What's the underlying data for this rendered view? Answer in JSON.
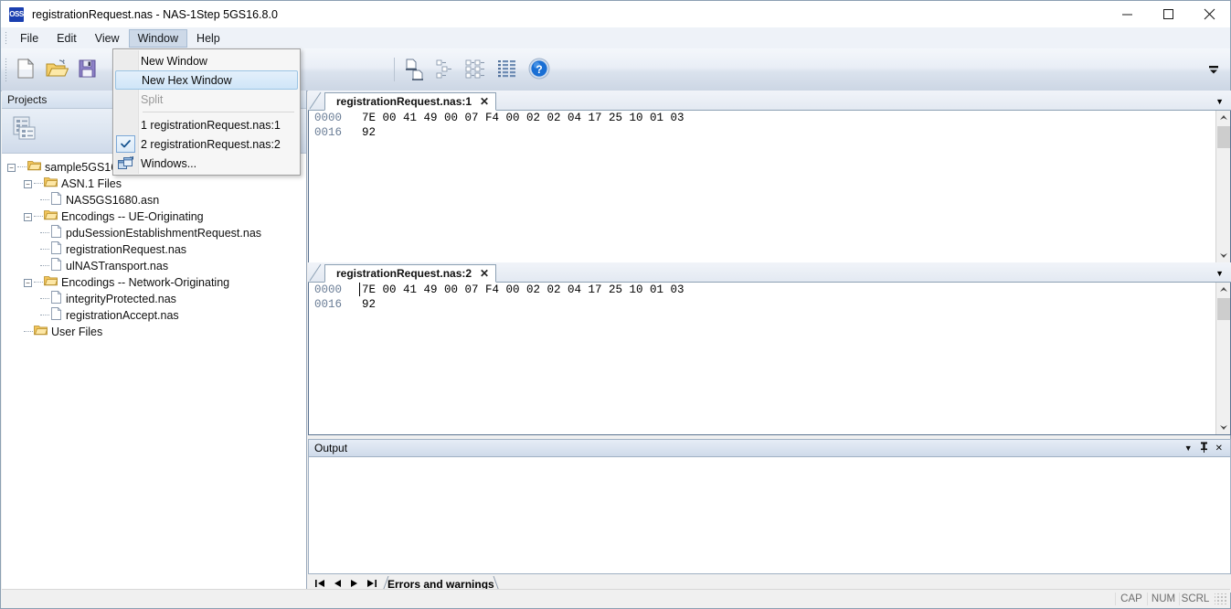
{
  "window": {
    "app_icon_text": "OSS",
    "title": "registrationRequest.nas - NAS-1Step 5GS16.8.0",
    "minimize": "—",
    "maximize": "□",
    "close": "✕"
  },
  "menubar": {
    "items": [
      {
        "label": "File",
        "active": false
      },
      {
        "label": "Edit",
        "active": false
      },
      {
        "label": "View",
        "active": false
      },
      {
        "label": "Window",
        "active": true
      },
      {
        "label": "Help",
        "active": false
      }
    ]
  },
  "window_menu": {
    "items": [
      {
        "label": "New Window",
        "state": "normal",
        "gutter": "none"
      },
      {
        "label": "New Hex Window",
        "state": "highlighted",
        "gutter": "none"
      },
      {
        "label": "Split",
        "state": "disabled",
        "gutter": "none"
      },
      {
        "label": "separator",
        "state": "separator",
        "gutter": "none"
      },
      {
        "label": "1 registrationRequest.nas:1",
        "state": "normal",
        "gutter": "none"
      },
      {
        "label": "2 registrationRequest.nas:2",
        "state": "normal",
        "gutter": "check"
      },
      {
        "label": "Windows...",
        "state": "normal",
        "gutter": "cascade-icon"
      }
    ]
  },
  "toolbar": {
    "buttons": [
      "new-document-icon",
      "open-folder-icon",
      "save-icon",
      "compare-documents-icon",
      "tree-view-icon",
      "tree-view-expanded-icon",
      "grid-view-icon",
      "help-icon"
    ],
    "overflow_label": "▼"
  },
  "projects_panel": {
    "header": "Projects",
    "toolstrip_icon": "project-list-icon",
    "tree": [
      {
        "depth": 0,
        "label": "sample5GS168",
        "type": "folder",
        "expander": "-"
      },
      {
        "depth": 1,
        "label": "ASN.1 Files",
        "type": "folder",
        "expander": "-"
      },
      {
        "depth": 2,
        "label": "NAS5GS1680.asn",
        "type": "file",
        "expander": ""
      },
      {
        "depth": 1,
        "label": "Encodings -- UE-Originating",
        "type": "folder",
        "expander": "-"
      },
      {
        "depth": 2,
        "label": "pduSessionEstablishmentRequest.nas",
        "type": "file",
        "expander": ""
      },
      {
        "depth": 2,
        "label": "registrationRequest.nas",
        "type": "file",
        "expander": ""
      },
      {
        "depth": 2,
        "label": "ulNASTransport.nas",
        "type": "file",
        "expander": ""
      },
      {
        "depth": 1,
        "label": "Encodings -- Network-Originating",
        "type": "folder",
        "expander": "-"
      },
      {
        "depth": 2,
        "label": "integrityProtected.nas",
        "type": "file",
        "expander": ""
      },
      {
        "depth": 2,
        "label": "registrationAccept.nas",
        "type": "file",
        "expander": ""
      },
      {
        "depth": 1,
        "label": "User Files",
        "type": "folder",
        "expander": ""
      }
    ]
  },
  "editors": [
    {
      "tab_label": "registrationRequest.nas:1",
      "close_label": "✕",
      "tabstrip_dropdown": "▼",
      "has_caret": false,
      "rows": [
        {
          "offset": "0000",
          "bytes": "7E 00 41 49 00 07 F4 00 02 02 04 17 25 10 01 03"
        },
        {
          "offset": "0016",
          "bytes": "92"
        }
      ]
    },
    {
      "tab_label": "registrationRequest.nas:2",
      "close_label": "✕",
      "tabstrip_dropdown": "▼",
      "has_caret": true,
      "rows": [
        {
          "offset": "0000",
          "bytes": "7E 00 41 49 00 07 F4 00 02 02 04 17 25 10 01 03"
        },
        {
          "offset": "0016",
          "bytes": "92"
        }
      ]
    }
  ],
  "output_panel": {
    "title": "Output",
    "dropdown_icon": "▼",
    "pin_icon": "⟐",
    "close_icon": "✕",
    "body_text": "",
    "nav": {
      "first": "◀|",
      "prev": "◀",
      "next": "▶",
      "last": "|▶"
    },
    "tab_label": "Errors and warnings"
  },
  "statusbar": {
    "indicators": [
      "CAP",
      "NUM",
      "SCRL"
    ]
  },
  "colors": {
    "accent": "#1a3fb0",
    "menu_highlight": "#cdd9e8",
    "hex_offset": "#6a7d96",
    "folder": "#e8b84b"
  }
}
